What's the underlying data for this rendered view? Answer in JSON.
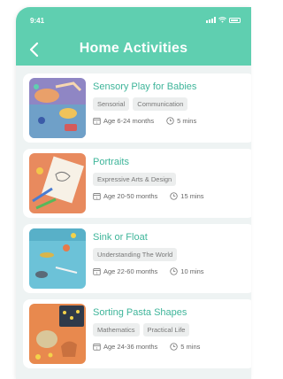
{
  "status": {
    "time": "9:41"
  },
  "header": {
    "title": "Home Activities"
  },
  "activities": [
    {
      "title": "Sensory Play for Babies",
      "tags": [
        "Sensorial",
        "Communication"
      ],
      "age": "Age 6-24 months",
      "duration": "5 mins"
    },
    {
      "title": "Portraits",
      "tags": [
        "Expressive Arts & Design"
      ],
      "age": "Age 20-50 months",
      "duration": "15 mins"
    },
    {
      "title": "Sink or Float",
      "tags": [
        "Understanding The World"
      ],
      "age": "Age 22-60 months",
      "duration": "10 mins"
    },
    {
      "title": "Sorting Pasta Shapes",
      "tags": [
        "Mathematics",
        "Practical Life"
      ],
      "age": "Age 24-36 months",
      "duration": "5 mins"
    }
  ],
  "colors": {
    "header": "#5fcfb0",
    "accent": "#3fb59a",
    "background": "#eef3f3"
  },
  "icons": [
    "back-arrow-icon",
    "calendar-icon",
    "clock-icon",
    "signal-icon",
    "wifi-icon",
    "battery-icon"
  ]
}
